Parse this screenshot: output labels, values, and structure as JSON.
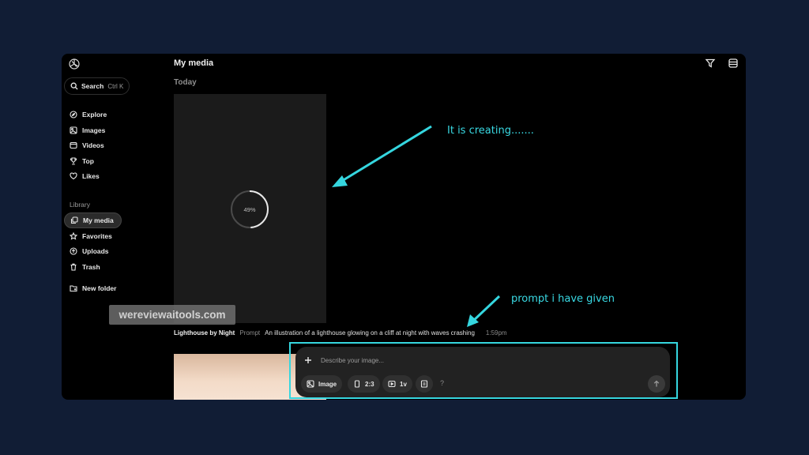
{
  "header": {
    "title": "My media"
  },
  "sidebar": {
    "search_label": "Search",
    "search_shortcut": "Ctrl K",
    "items": [
      {
        "label": "Explore",
        "icon": "compass-icon"
      },
      {
        "label": "Images",
        "icon": "image-icon"
      },
      {
        "label": "Videos",
        "icon": "video-icon"
      },
      {
        "label": "Top",
        "icon": "trophy-icon"
      },
      {
        "label": "Likes",
        "icon": "heart-icon"
      }
    ],
    "library_label": "Library",
    "library_items": [
      {
        "label": "My media",
        "icon": "media-icon",
        "active": true
      },
      {
        "label": "Favorites",
        "icon": "star-icon"
      },
      {
        "label": "Uploads",
        "icon": "upload-icon"
      },
      {
        "label": "Trash",
        "icon": "trash-icon"
      }
    ],
    "new_folder_label": "New folder"
  },
  "main": {
    "group_label": "Today",
    "generating": {
      "progress": 49,
      "progress_label": "49%"
    },
    "item_meta": {
      "title": "Lighthouse by Night",
      "prompt_label": "Prompt",
      "prompt": "An illustration of a lighthouse glowing  on a cliff at night with waves crashing",
      "time": "1:59pm"
    }
  },
  "composer": {
    "placeholder": "Describe your image...",
    "mode_label": "Image",
    "aspect_label": "2:3",
    "version_label": "1v",
    "help_label": "?"
  },
  "annotations": {
    "creating": "It is creating.......",
    "prompt_note": "prompt i have given",
    "watermark": "wereviewaitools.com"
  },
  "colors": {
    "accent": "#35d6df",
    "page_bg": "#111d35",
    "app_bg": "#000000"
  }
}
